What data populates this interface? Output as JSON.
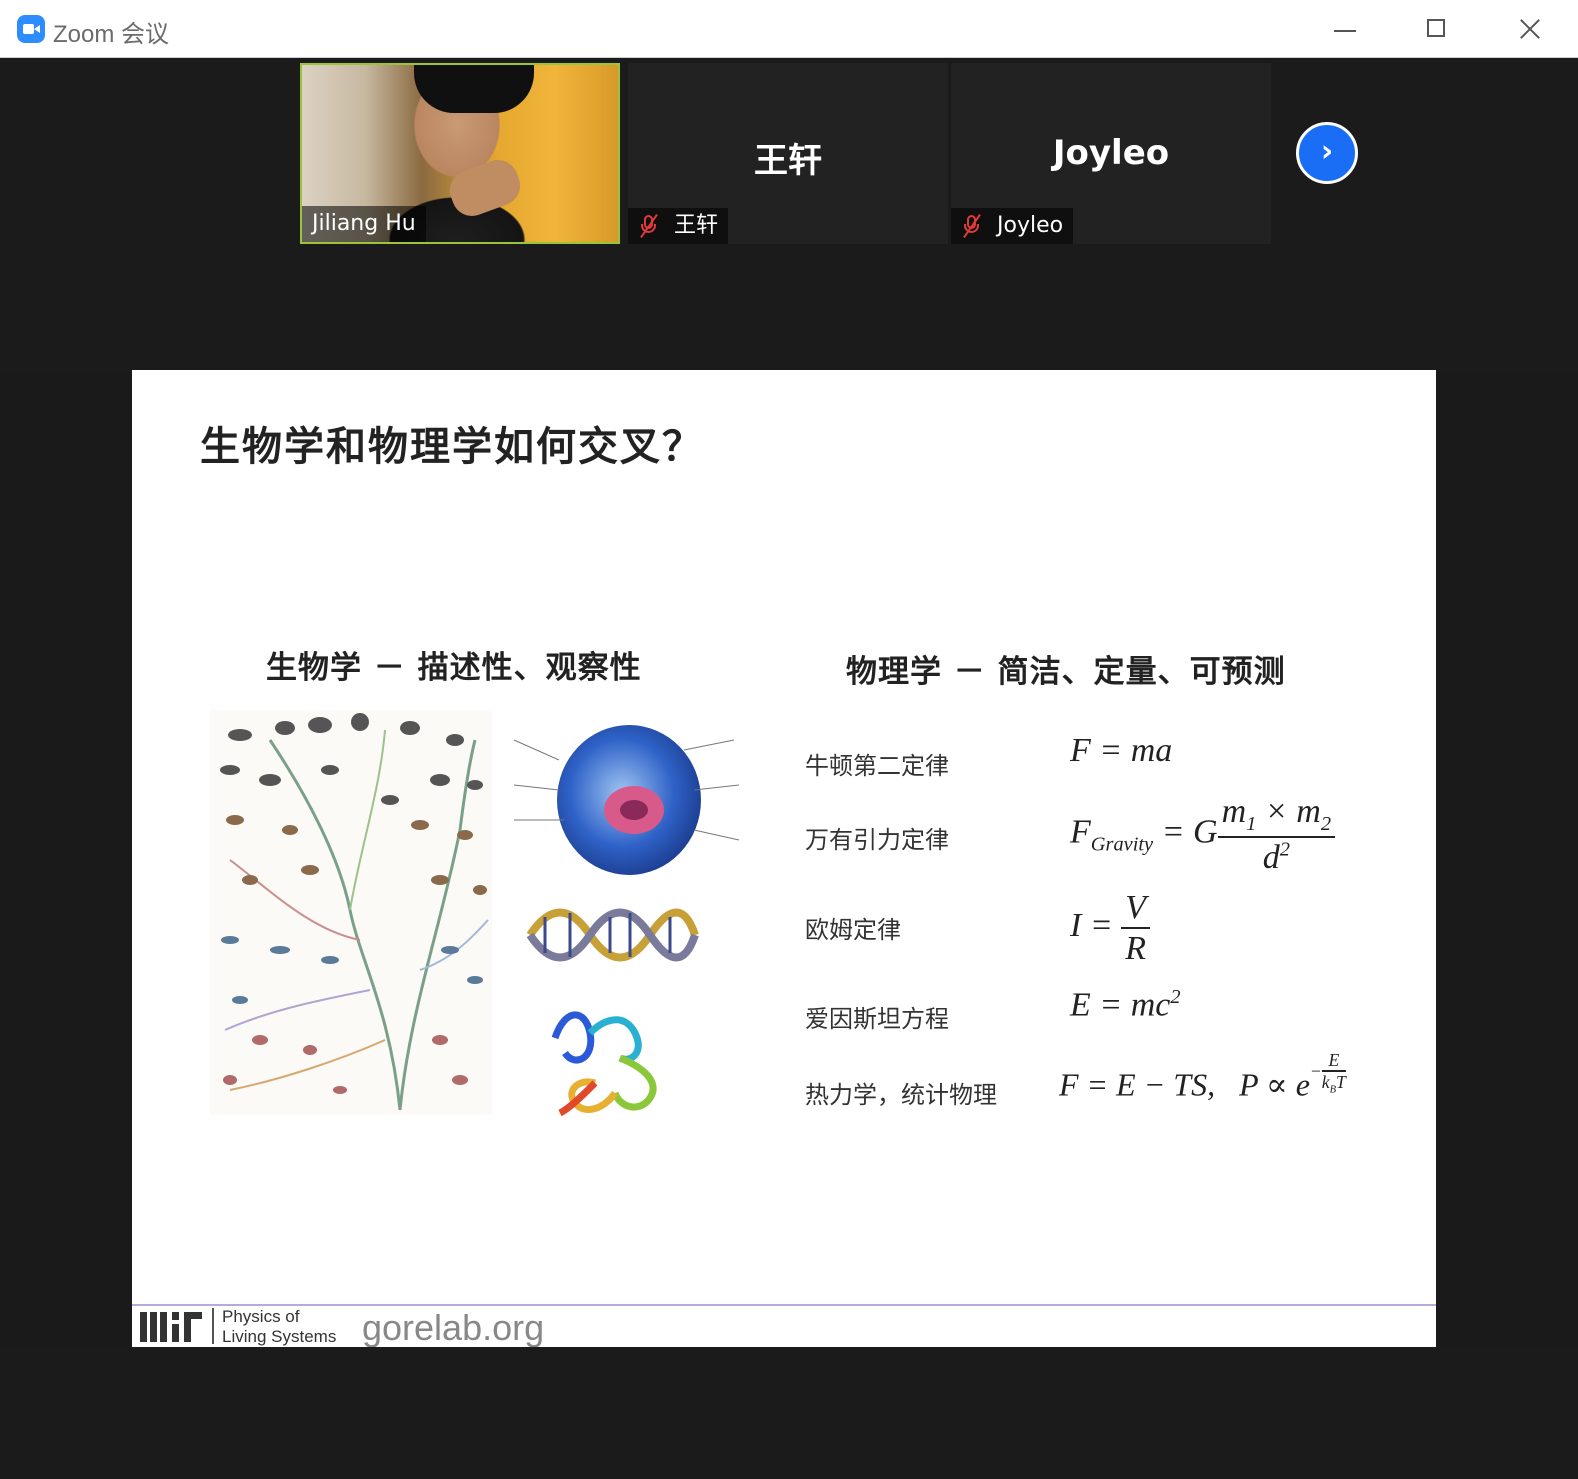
{
  "window": {
    "title": "Zoom 会议"
  },
  "participants": [
    {
      "name": "Jiliang Hu",
      "video": true
    },
    {
      "name": "王轩",
      "display": "王轩",
      "muted": true
    },
    {
      "name": "Joyleo",
      "display": "Joyleo",
      "muted": true
    }
  ],
  "strip": {
    "next_glyph": "›"
  },
  "slide": {
    "title": "生物学和物理学如何交叉？",
    "bio_heading": "生物学 － 描述性、观察性",
    "phy_heading": "物理学 － 简洁、定量、可预测",
    "laws": [
      {
        "name": "牛顿第二定律",
        "formula": "F = ma"
      },
      {
        "name": "万有引力定律",
        "formula": "F_Gravity = G m1×m2 / d^2"
      },
      {
        "name": "欧姆定律",
        "formula": "I = V / R"
      },
      {
        "name": "爱因斯坦方程",
        "formula": "E = mc^2"
      },
      {
        "name": "热力学，统计物理",
        "formula": "F = E − TS,  P ∝ e^(−E/kBT)"
      }
    ],
    "footer": {
      "lab_line1": "Physics of",
      "lab_line2": "Living Systems",
      "url": "gorelab.org"
    }
  },
  "colors": {
    "accent": "#2d8cff",
    "next_button": "#1a6ef5",
    "active_speaker_border": "#9cc43a",
    "muted_icon": "#e03a3a"
  }
}
